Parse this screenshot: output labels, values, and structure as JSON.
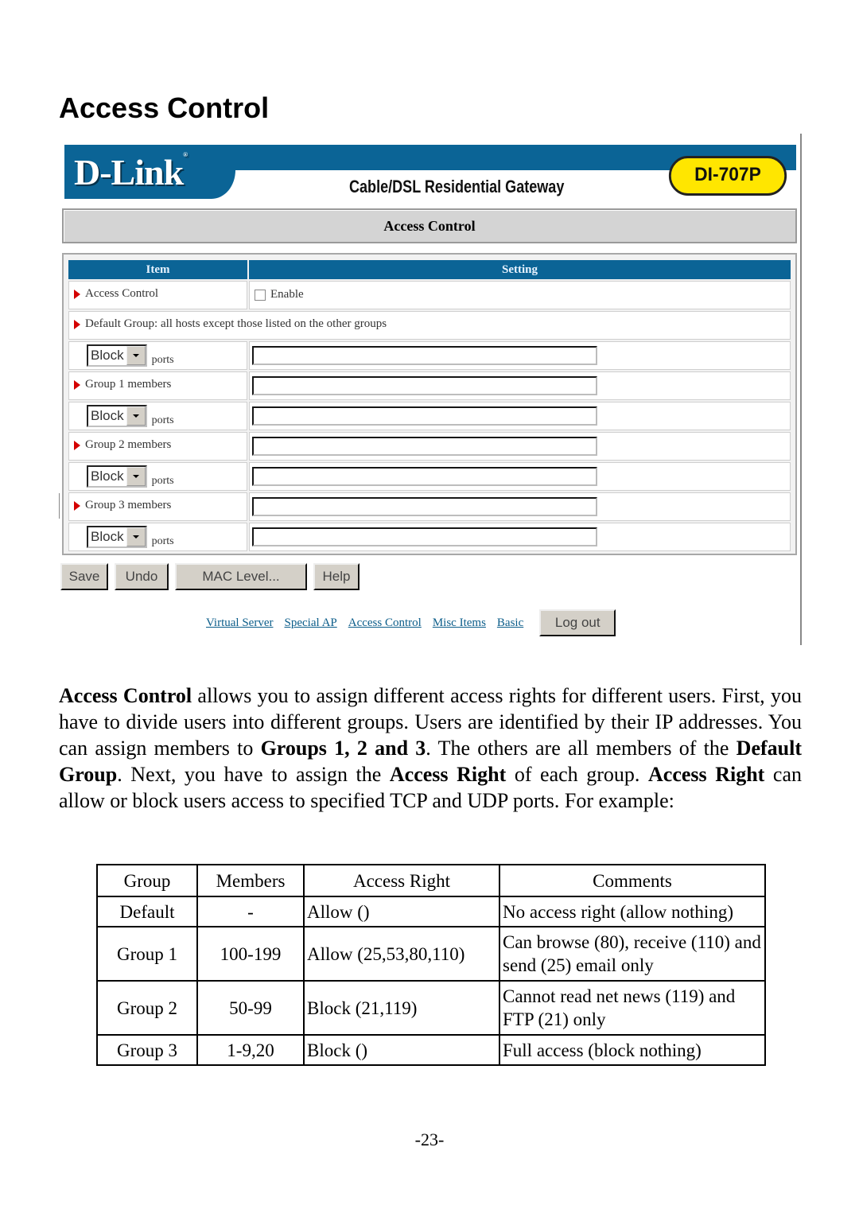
{
  "heading": "Access Control",
  "router_ui": {
    "brand": "D-Link",
    "product_line": "Cable/DSL Residential Gateway",
    "model": "DI-707P",
    "page_title": "Access Control",
    "colors": {
      "header_blue": "#0b6496",
      "badge_yellow": "#ffe600",
      "arrow_red": "#d40000",
      "link_blue": "#0b5d8a"
    },
    "table_headers": {
      "item": "Item",
      "setting": "Setting"
    },
    "access_control": {
      "label": "Access Control",
      "checkbox_label": "Enable",
      "checked": false
    },
    "default_group_label": "Default Group: all hosts except those listed on the other groups",
    "ports_rows": [
      {
        "select_value": "Block",
        "suffix": "ports",
        "input_value": ""
      },
      {
        "select_value": "Block",
        "suffix": "ports",
        "input_value": ""
      },
      {
        "select_value": "Block",
        "suffix": "ports",
        "input_value": ""
      },
      {
        "select_value": "Block",
        "suffix": "ports",
        "input_value": ""
      }
    ],
    "group_rows": [
      {
        "label": "Group 1 members",
        "input_value": ""
      },
      {
        "label": "Group 2 members",
        "input_value": ""
      },
      {
        "label": "Group 3 members",
        "input_value": ""
      }
    ],
    "buttons": {
      "save": "Save",
      "undo": "Undo",
      "mac_level": "MAC Level...",
      "help": "Help"
    },
    "nav_links": [
      "Virtual Server",
      "Special AP",
      "Access Control",
      "Misc Items",
      "Basic"
    ],
    "logout": "Log out"
  },
  "paragraph": {
    "s1_bold": "Access Control",
    "s1": " allows you to assign different access rights for different users. First, you have to divide users into different groups. Users are identified by their IP addresses. You can assign members to ",
    "s2_bold": "Groups 1, 2 and 3",
    "s2": ". The others are all members of the ",
    "s3_bold": "Default Group",
    "s3": ". Next, you have to assign the ",
    "s4_bold": "Access Right",
    "s4": " of each group. ",
    "s5_bold": "Access Right",
    "s5": " can allow or block users access to specified TCP and UDP ports. For example:"
  },
  "example_table": {
    "headers": [
      "Group",
      "Members",
      "Access Right",
      "Comments"
    ],
    "rows": [
      [
        "Default",
        "-",
        "Allow ()",
        "No access right (allow nothing)"
      ],
      [
        "Group 1",
        "100-199",
        "Allow (25,53,80,110)",
        "Can browse (80), receive (110) and send (25) email only"
      ],
      [
        "Group 2",
        "50-99",
        "Block (21,119)",
        "Cannot read net news (119) and FTP (21) only"
      ],
      [
        "Group 3",
        "1-9,20",
        "Block ()",
        "Full access (block nothing)"
      ]
    ]
  },
  "page_number": "-23-"
}
